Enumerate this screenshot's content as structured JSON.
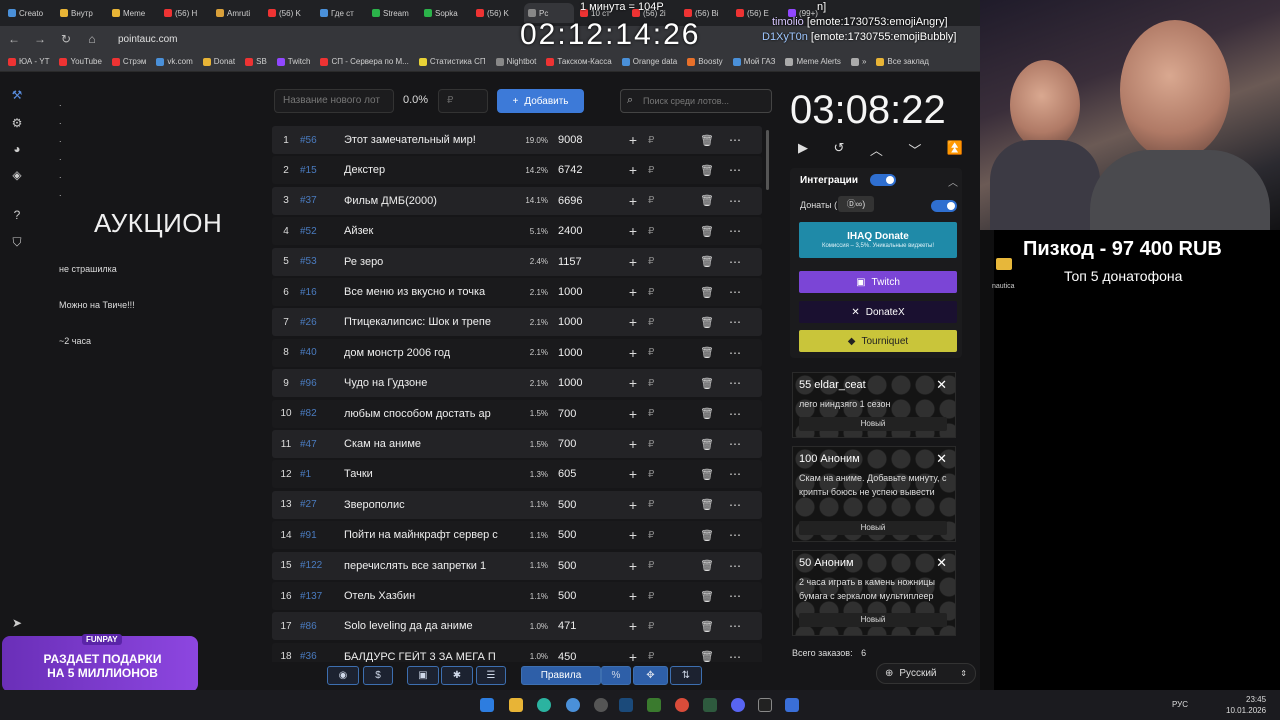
{
  "browser": {
    "tabs": [
      "Creato",
      "Внутр",
      "Meme",
      "(56) H",
      "Amruti",
      "(56) K",
      "Где ст",
      "Stream",
      "Sopka",
      "(56) K",
      "Pc",
      "10 ст",
      "(56) 2i",
      "(56) Bi",
      "(56) E",
      "(99+)"
    ],
    "url": "pointauc.com",
    "bookmarks": [
      "ЮА - YT",
      "YouTube",
      "Стрэм",
      "vk.com",
      "Donat",
      "SB",
      "Twitch",
      "СП - Сервера по М...",
      "Статистика СП",
      "Nightbot",
      "Такском-Касса",
      "Orange data",
      "Boosty",
      "Мой ГАЗ",
      "Meme Alerts",
      "»",
      "Все заклад"
    ]
  },
  "notes": {
    "dots": [
      ".",
      ".",
      ".",
      ".",
      ".",
      "."
    ],
    "title": "АУКЦИОН",
    "line1": "не страшилка",
    "line2": "Можно на  Твиче!!!",
    "line3": "~2 часа"
  },
  "controls": {
    "lot_placeholder": "Название нового лот",
    "percent": "0.0%",
    "amount_placeholder": "₽",
    "add_label": "Добавить",
    "search_placeholder": "Поиск среди лотов..."
  },
  "lots": [
    {
      "idx": "1",
      "id": "#56",
      "name": "Этот замечательный мир!",
      "pct": "19.0%",
      "amount": "9008"
    },
    {
      "idx": "2",
      "id": "#15",
      "name": "Декстер",
      "pct": "14.2%",
      "amount": "6742"
    },
    {
      "idx": "3",
      "id": "#37",
      "name": "Фильм ДМБ(2000)",
      "pct": "14.1%",
      "amount": "6696"
    },
    {
      "idx": "4",
      "id": "#52",
      "name": "Айзек",
      "pct": "5.1%",
      "amount": "2400"
    },
    {
      "idx": "5",
      "id": "#53",
      "name": "Ре зеро",
      "pct": "2.4%",
      "amount": "1157"
    },
    {
      "idx": "6",
      "id": "#16",
      "name": "Все меню из вкусно и точка",
      "pct": "2.1%",
      "amount": "1000"
    },
    {
      "idx": "7",
      "id": "#26",
      "name": "Птицекалипсис: Шок и трепе",
      "pct": "2.1%",
      "amount": "1000"
    },
    {
      "idx": "8",
      "id": "#40",
      "name": "дом монстр 2006 год",
      "pct": "2.1%",
      "amount": "1000"
    },
    {
      "idx": "9",
      "id": "#96",
      "name": "Чудо на Гудзоне",
      "pct": "2.1%",
      "amount": "1000"
    },
    {
      "idx": "10",
      "id": "#82",
      "name": "любым способом достать ар",
      "pct": "1.5%",
      "amount": "700"
    },
    {
      "idx": "11",
      "id": "#47",
      "name": "Скам на аниме",
      "pct": "1.5%",
      "amount": "700"
    },
    {
      "idx": "12",
      "id": "#1",
      "name": "Тачки",
      "pct": "1.3%",
      "amount": "605"
    },
    {
      "idx": "13",
      "id": "#27",
      "name": "Зверополис",
      "pct": "1.1%",
      "amount": "500"
    },
    {
      "idx": "14",
      "id": "#91",
      "name": "Пойти на майнкрафт сервер с",
      "pct": "1.1%",
      "amount": "500"
    },
    {
      "idx": "15",
      "id": "#122",
      "name": "перечислять все запретки 1",
      "pct": "1.1%",
      "amount": "500"
    },
    {
      "idx": "16",
      "id": "#137",
      "name": "Отель Хазбин",
      "pct": "1.1%",
      "amount": "500"
    },
    {
      "idx": "17",
      "id": "#86",
      "name": "Solo leveling да да аниме",
      "pct": "1.0%",
      "amount": "471"
    },
    {
      "idx": "18",
      "id": "#36",
      "name": "БАЛДУРС ГЕЙТ 3 ЗА МЕГА П",
      "pct": "1.0%",
      "amount": "450"
    }
  ],
  "row_icons": {
    "plus": "+",
    "rub": "₽",
    "delete": "🗑",
    "more": "⋯"
  },
  "toolbar": {
    "rules_label": "Правила",
    "percent_label": "%",
    "dollar": "$"
  },
  "timer": {
    "value": "03:08:22"
  },
  "integrations": {
    "title": "Интеграции",
    "donations_label": "Донаты (",
    "ihaq_label": "IHAQ Donate",
    "ihaq_sub": "Комиссия – 3,5%. Уникальные виджеты!",
    "twitch_label": "Twitch",
    "donatex_label": "DonateX",
    "tourniquet_label": "Tourniquet"
  },
  "donations": [
    {
      "header": "55 eldar_ceat",
      "message": "лего ниндзяго 1 сезон",
      "status": "Новый"
    },
    {
      "header": "100 Аноним",
      "message": "Скам на аниме. Добавьте минуту, с крипты боюсь не успею вывести",
      "status": "Новый"
    },
    {
      "header": "50 Аноним",
      "message": "2 часа играть в камень ножницы бумага с зеркалом мультиплеер",
      "status": "Новый"
    }
  ],
  "orders": {
    "label": "Всего заказов:",
    "count": "6"
  },
  "language": "Русский",
  "overlay": {
    "rate": "1 минута = 104Р",
    "big_timer": "02:12:14:26",
    "chat1": "timolio",
    "chat1_msg": "[emote:1730753:emojiAngry]",
    "chat2": "D1XyT0n",
    "chat2_msg": "[emote:1730755:emojiBubbly]",
    "chat_top": "n]"
  },
  "stream": {
    "top_donor": "Пизкод - 97 400 RUB",
    "top_label": "Топ  5 донатофона",
    "folder_label": "nautica"
  },
  "promo": {
    "brand": "FUNPAY",
    "text": "РАЗДАЕТ ПОДАРКИ НА 5 МИЛЛИОНОВ"
  },
  "taskbar": {
    "lang": "РУС",
    "time": "23:45",
    "date": "10.01.2026"
  },
  "colors": {
    "accent": "#3d7ad8",
    "twitch": "#7b45d6",
    "donatex": "#1a1030",
    "tourniquet": "#c9c53a",
    "ihaq": "#1f8aa8"
  }
}
